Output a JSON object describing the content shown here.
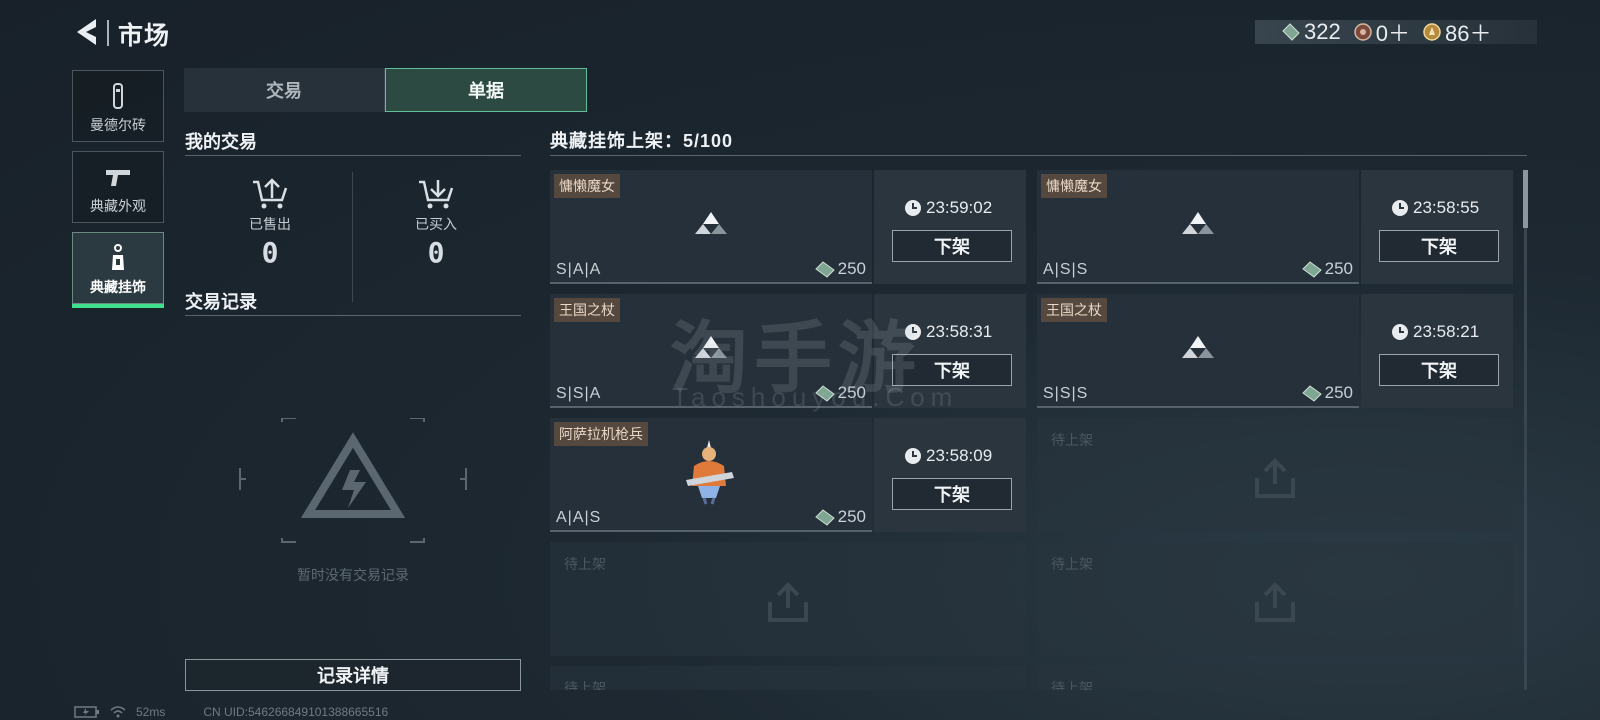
{
  "header": {
    "title": "市场",
    "back_icon": "back-arrow-icon"
  },
  "currency": [
    {
      "icon": "ticket-icon",
      "value": "322"
    },
    {
      "icon": "gear-coin-icon",
      "value": "0＋"
    },
    {
      "icon": "gold-coin-icon",
      "value": "86＋"
    }
  ],
  "sidebar": [
    {
      "label": "曼德尔砖",
      "icon": "brick-icon",
      "active": false
    },
    {
      "label": "典藏外观",
      "icon": "pistol-icon",
      "active": false
    },
    {
      "label": "典藏挂饰",
      "icon": "charm-icon",
      "active": true
    }
  ],
  "tabs": [
    {
      "label": "交易",
      "active": false
    },
    {
      "label": "单据",
      "active": true
    }
  ],
  "my_trades": {
    "title": "我的交易",
    "sold_label": "已售出",
    "sold_value": "0",
    "bought_label": "已买入",
    "bought_value": "0"
  },
  "records": {
    "title": "交易记录",
    "empty_text": "暂时没有交易记录",
    "detail_button": "记录详情"
  },
  "status": {
    "ping": "52ms",
    "uid": "CN UID:546266849101388665516"
  },
  "listing": {
    "title": "典藏挂饰上架：5/100",
    "listings": [
      {
        "name": "慵懒魔女",
        "grade": "S|A|A",
        "price": "250",
        "timer": "23:59:02",
        "button": "下架"
      },
      {
        "name": "慵懒魔女",
        "grade": "A|S|S",
        "price": "250",
        "timer": "23:58:55",
        "button": "下架"
      },
      {
        "name": "王国之杖",
        "grade": "S|S|A",
        "price": "250",
        "timer": "23:58:31",
        "button": "下架"
      },
      {
        "name": "王国之杖",
        "grade": "S|S|S",
        "price": "250",
        "timer": "23:58:21",
        "button": "下架"
      },
      {
        "name": "阿萨拉机枪兵",
        "grade": "A|A|S",
        "price": "250",
        "timer": "23:58:09",
        "button": "下架"
      }
    ],
    "empty_slot_label": "待上架"
  },
  "watermark": {
    "main": "淘手游",
    "sub": "Taoshouyou.Com"
  },
  "colors": {
    "accent": "#3fe08c",
    "tag_bg": "#54483f",
    "bg": "#1d2831"
  }
}
